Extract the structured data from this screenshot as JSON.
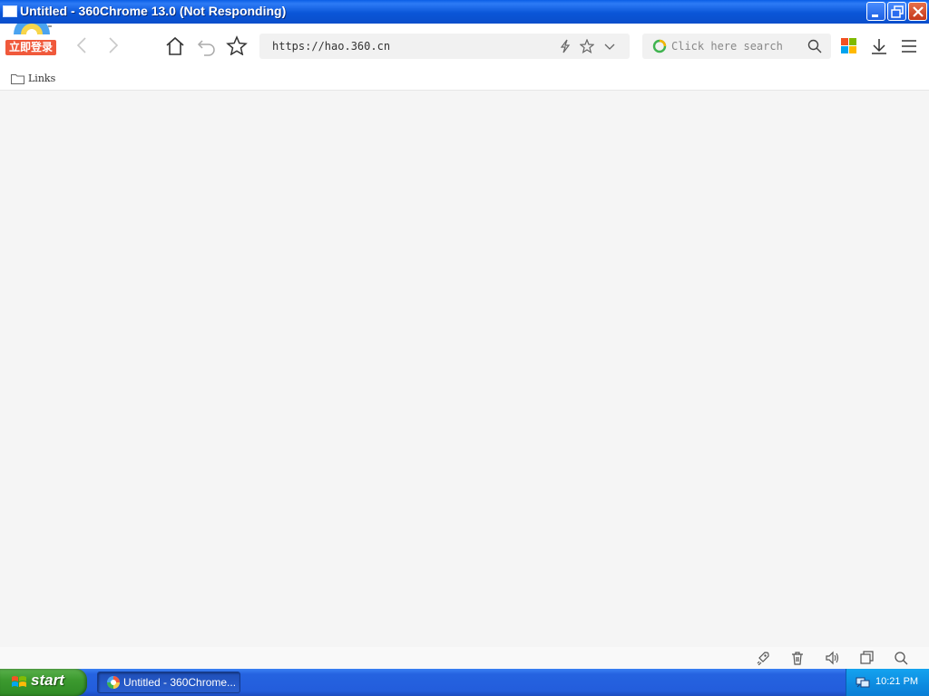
{
  "window": {
    "title": "Untitled - 360Chrome 13.0 (Not Responding)"
  },
  "toolbar": {
    "login_label": "立即登录",
    "address": {
      "value": "https://hao.360.cn"
    },
    "search": {
      "placeholder": "Click here search"
    }
  },
  "bookmarks": {
    "items": [
      {
        "label": "Links",
        "icon": "folder-icon"
      }
    ]
  },
  "taskbar": {
    "start_label": "start",
    "tasks": [
      {
        "label": "Untitled - 360Chrome..."
      }
    ],
    "clock": "10:21 PM"
  },
  "colors": {
    "login_bg": "#f0593b",
    "titlebar": "#0a56d8",
    "taskbar": "#235ddc",
    "start_button": "#3c9a2f",
    "tray": "#0d8be0",
    "content_bg": "#f5f5f5"
  }
}
